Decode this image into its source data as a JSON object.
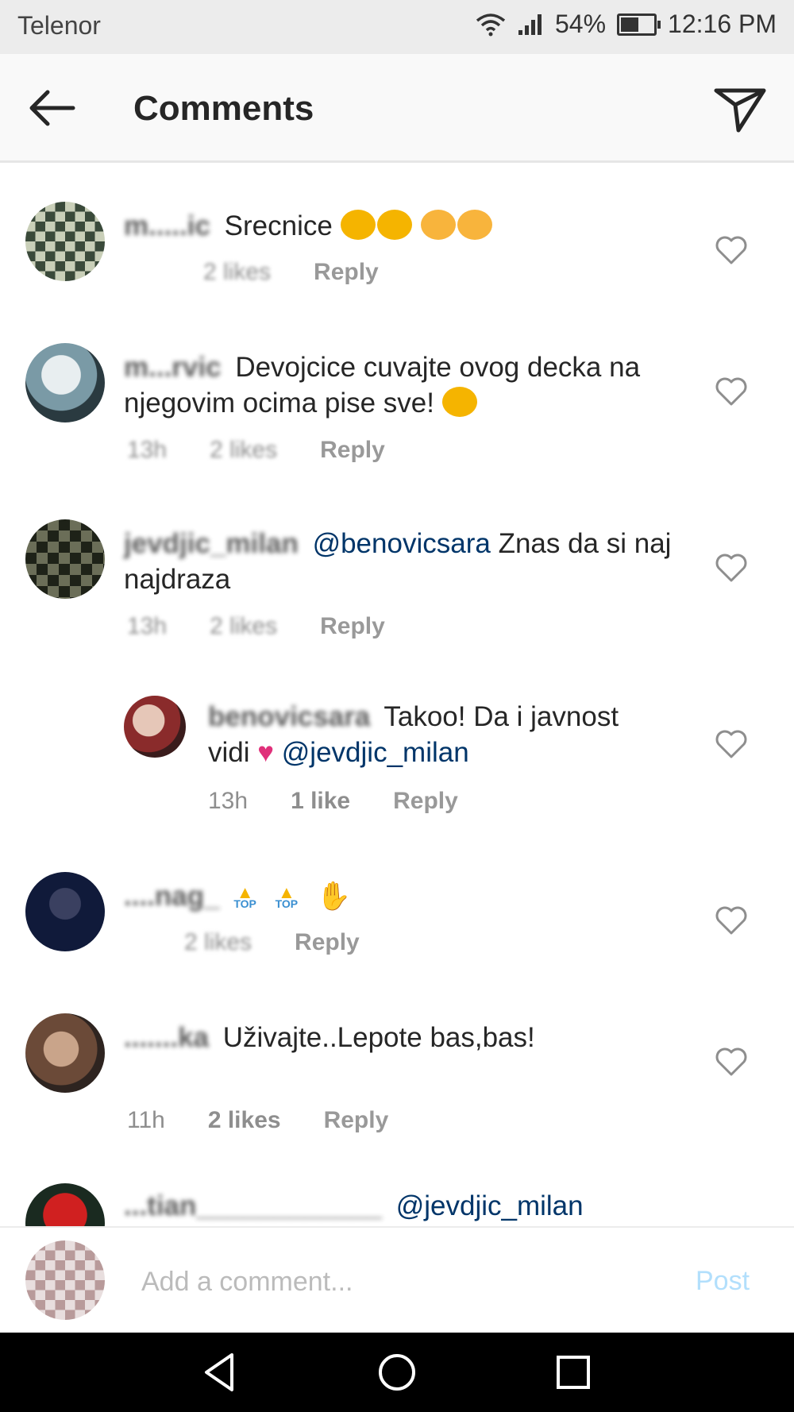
{
  "status_bar": {
    "carrier": "Telenor",
    "battery": "54%",
    "battery_level": 0.54,
    "time": "12:16 PM"
  },
  "header": {
    "title": "Comments"
  },
  "comments": [
    {
      "username": "m.....ic",
      "text": "Srecnice",
      "time": "",
      "likes": "2 likes",
      "reply": "Reply"
    },
    {
      "username": "m...rvic",
      "text": "Devojcice cuvajte ovog decka na njegovim ocima pise sve!",
      "time": "13h",
      "likes": "2 likes",
      "reply": "Reply"
    },
    {
      "username": "jevdjic_milan",
      "mention": "@benovicsara",
      "text": "Znas da si naj najdraza",
      "time": "13h",
      "likes": "2 likes",
      "reply": "Reply"
    },
    {
      "username": "benovicsara",
      "text": "Takoo! Da i javnost vidi",
      "mention": "@jevdjic_milan",
      "time": "13h",
      "likes": "1 like",
      "reply": "Reply"
    },
    {
      "username": "....nag_",
      "text": "",
      "time": "",
      "likes": "2 likes",
      "reply": "Reply"
    },
    {
      "username": ".......ka",
      "text": "Uživajte..Lepote bas,bas!",
      "time": "11h",
      "likes": "2 likes",
      "reply": "Reply"
    },
    {
      "username": "...tian____________",
      "mention": "@jevdjic_milan"
    }
  ],
  "input": {
    "placeholder": "Add a comment...",
    "post_label": "Post"
  },
  "colors": {
    "mention": "#003569",
    "post": "#b2dffc",
    "meta": "#8e8e8e"
  }
}
